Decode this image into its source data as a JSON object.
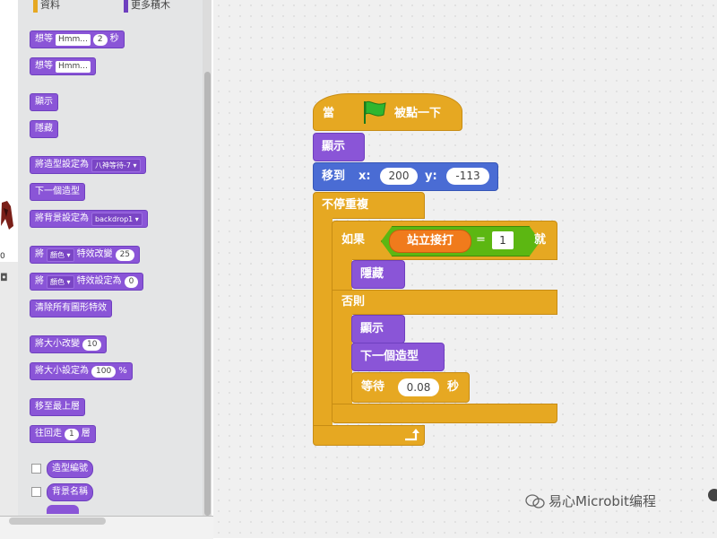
{
  "palette": {
    "categories": [
      {
        "label": "資料",
        "color": "#e6a822"
      },
      {
        "label": "更多積木",
        "color": "#6e3fbf"
      }
    ],
    "blocks": {
      "think_secs": {
        "text": "想等",
        "input": "Hmm...",
        "num": "2",
        "unit": "秒"
      },
      "think": {
        "text": "想等",
        "input": "Hmm..."
      },
      "show": "顯示",
      "hide": "隱藏",
      "switch_costume": {
        "text": "將造型設定為",
        "dropdown": "八神等待-7"
      },
      "next_costume": "下一個造型",
      "switch_backdrop": {
        "text": "將背景設定為",
        "dropdown": "backdrop1"
      },
      "change_effect": {
        "text1": "將",
        "dropdown": "顏色",
        "text2": "特效改變",
        "num": "25"
      },
      "set_effect": {
        "text1": "將",
        "dropdown": "顏色",
        "text2": "特效設定為",
        "num": "0"
      },
      "clear_effects": "清除所有圖形特效",
      "change_size": {
        "text": "將大小改變",
        "num": "10"
      },
      "set_size": {
        "text": "將大小設定為",
        "num": "100",
        "unit": "%"
      },
      "go_front": "移至最上層",
      "go_back": {
        "text1": "往回走",
        "num": "1",
        "text2": "層"
      },
      "costume_num": "造型編號",
      "backdrop_name": "背景名稱"
    }
  },
  "stage": {
    "readout": "0"
  },
  "script": {
    "hat": {
      "when": "當",
      "clicked": "被點一下"
    },
    "show": "顯示",
    "goto": {
      "label": "移到",
      "x_label": "x:",
      "x": "200",
      "y_label": "y:",
      "y": "-113"
    },
    "forever": "不停重複",
    "if": {
      "label": "如果",
      "sensor": "站立接打",
      "eq": "=",
      "value": "1",
      "then": "就"
    },
    "hide": "隱藏",
    "else": "否則",
    "show2": "顯示",
    "next_costume": "下一個造型",
    "wait": {
      "label": "等待",
      "secs": "0.08",
      "unit": "秒"
    }
  },
  "watermark": "易心Microbit编程",
  "colors": {
    "looks": "#8a55d7",
    "motion": "#4a6cd4",
    "control": "#e6a822",
    "operator": "#5cb712",
    "sensing": "#f07b1c"
  }
}
